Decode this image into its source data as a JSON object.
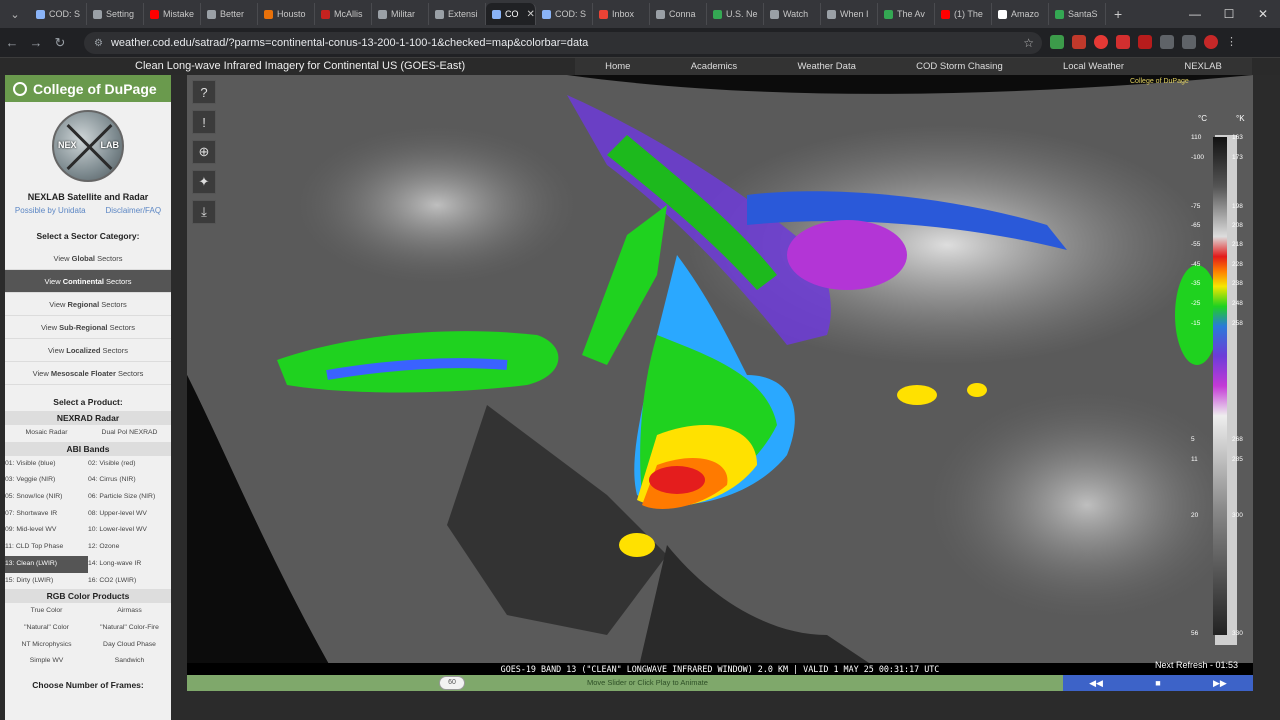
{
  "browser": {
    "tabs": [
      {
        "label": "COD: S",
        "color": "#8ab4f8"
      },
      {
        "label": "Setting",
        "color": "#9aa0a6"
      },
      {
        "label": "Mistake",
        "color": "#ff0000"
      },
      {
        "label": "Better",
        "color": "#9aa0a6"
      },
      {
        "label": "Housto",
        "color": "#e8710a"
      },
      {
        "label": "McAllis",
        "color": "#c5221f"
      },
      {
        "label": "Militar",
        "color": "#9aa0a6"
      },
      {
        "label": "Extensi",
        "color": "#9aa0a6"
      },
      {
        "label": "CO",
        "color": "#8ab4f8"
      },
      {
        "label": "COD: S",
        "color": "#8ab4f8"
      },
      {
        "label": "Inbox",
        "color": "#ea4335"
      },
      {
        "label": "Conna",
        "color": "#9aa0a6"
      },
      {
        "label": "U.S. Ne",
        "color": "#34a853"
      },
      {
        "label": "Watch",
        "color": "#9aa0a6"
      },
      {
        "label": "When I",
        "color": "#9aa0a6"
      },
      {
        "label": "The Av",
        "color": "#34a853"
      },
      {
        "label": "(1) The",
        "color": "#ff0000"
      },
      {
        "label": "Amazo",
        "color": "#ffffff"
      },
      {
        "label": "SantaS",
        "color": "#34a853"
      }
    ],
    "new_tab": "+",
    "url": "weather.cod.edu/satrad/?parms=continental-conus-13-200-1-100-1&checked=map&colorbar=data"
  },
  "site": {
    "page_title": "Clean Long-wave Infrared Imagery for Continental US (GOES-East)",
    "nav": [
      "Home",
      "Academics",
      "Weather Data",
      "COD Storm Chasing",
      "Local Weather",
      "NEXLAB"
    ]
  },
  "sidebar": {
    "brand": "College of DuPage",
    "logo_left": "NEX",
    "logo_right": "LAB",
    "title": "NEXLAB Satellite and Radar",
    "link_unidata": "Possible by Unidata",
    "link_faq": "Disclaimer/FAQ",
    "sector_heading": "Select a Sector Category:",
    "sectors": [
      {
        "pre": "View ",
        "bold": "Global",
        "post": " Sectors",
        "active": false
      },
      {
        "pre": "View ",
        "bold": "Continental",
        "post": " Sectors",
        "active": true
      },
      {
        "pre": "View ",
        "bold": "Regional",
        "post": " Sectors",
        "active": false
      },
      {
        "pre": "View ",
        "bold": "Sub-Regional",
        "post": " Sectors",
        "active": false
      },
      {
        "pre": "View ",
        "bold": "Localized",
        "post": " Sectors",
        "active": false
      },
      {
        "pre": "View ",
        "bold": "Mesoscale Floater",
        "post": " Sectors",
        "active": false
      }
    ],
    "product_heading": "Select a Product:",
    "radar_heading": "NEXRAD Radar",
    "radar": [
      "Mosaic Radar",
      "Dual Pol NEXRAD"
    ],
    "abi_heading": "ABI Bands",
    "abi": [
      "01: Visible (blue)",
      "02: Visible (red)",
      "03: Veggie (NIR)",
      "04: Cirrus (NIR)",
      "05: Snow/Ice (NIR)",
      "06: Particle Size (NIR)",
      "07: Shortwave IR",
      "08: Upper-level WV",
      "09: Mid-level WV",
      "10: Lower-level WV",
      "11: CLD Top Phase",
      "12: Ozone",
      "13: Clean (LWIR)",
      "14: Long-wave IR",
      "15: Dirty (LWIR)",
      "16: CO2 (LWIR)"
    ],
    "abi_active": "13: Clean (LWIR)",
    "rgb_heading": "RGB Color Products",
    "rgb": [
      "True Color",
      "Airmass",
      "\"Natural\" Color",
      "\"Natural\" Color-Fire",
      "NT Microphysics",
      "Day Cloud Phase",
      "Simple WV",
      "Sandwich"
    ],
    "frames_heading": "Choose Number of Frames:"
  },
  "viewer": {
    "annotation": "GOES-19 BAND 13 (\"CLEAN\" LONGWAVE INFRARED WINDOW) 2.0 KM | VALID 1 MAY 25 00:31:17 UTC",
    "next_refresh": "Next Refresh - 01:53",
    "credit": "College of DuPage",
    "colorbar_units": [
      "°C",
      "°K"
    ],
    "colorbar_celsius": [
      "110",
      "-100",
      "-75",
      "-65",
      "-55",
      "-45",
      "-35",
      "-25",
      "-15",
      "5",
      "11",
      "20",
      "56"
    ],
    "colorbar_kelvin": [
      "163",
      "173",
      "198",
      "208",
      "218",
      "228",
      "238",
      "248",
      "258",
      "268",
      "285",
      "300",
      "330"
    ],
    "frames_value": "60",
    "slider_hint": "Move Slider or Click Play to Animate",
    "controls": [
      "◀◀",
      "■",
      "▶▶"
    ],
    "tool_icons": [
      "help-icon",
      "alert-icon",
      "globe-icon",
      "satellite-icon",
      "download-icon"
    ]
  }
}
